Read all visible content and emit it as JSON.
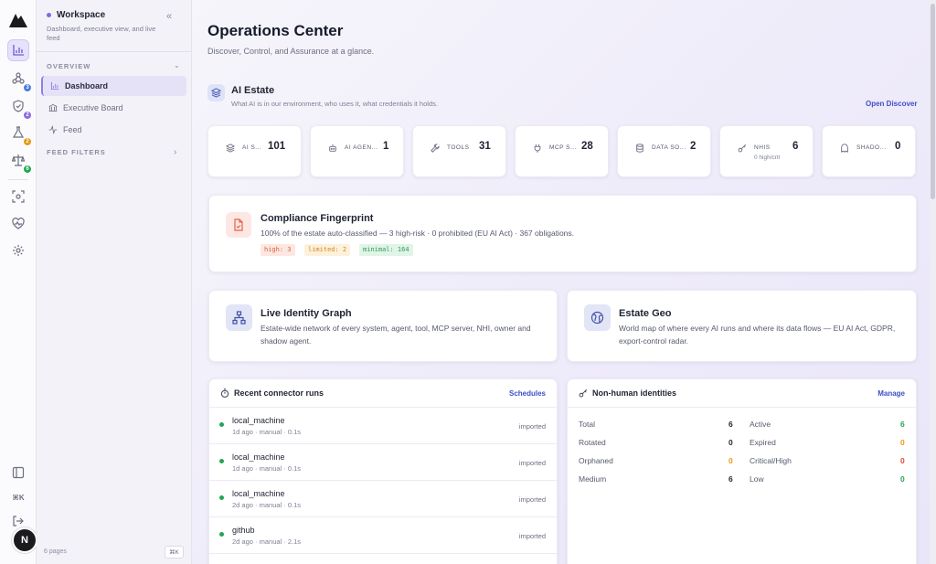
{
  "rail": {
    "badges": [
      "3",
      "2",
      "2",
      "6"
    ],
    "avatar": "N"
  },
  "sidebar": {
    "workspace_title": "Workspace",
    "workspace_sub": "Dashboard, executive view, and live feed",
    "sections": {
      "overview": "OVERVIEW",
      "feed_filters": "FEED FILTERS"
    },
    "items": [
      {
        "label": "Dashboard",
        "icon": "bar-chart-icon"
      },
      {
        "label": "Executive Board",
        "icon": "bank-icon"
      },
      {
        "label": "Feed",
        "icon": "activity-icon"
      }
    ],
    "footer_pages": "6 pages",
    "footer_shortcut": "⌘K"
  },
  "header": {
    "title": "Operations Center",
    "subtitle": "Discover, Control, and Assurance at a glance."
  },
  "estate": {
    "title": "AI Estate",
    "subtitle": "What AI is in our environment, who uses it, what credentials it holds.",
    "link": "Open Discover",
    "stats": [
      {
        "label": "AI S...",
        "value": "101",
        "icon": "layers-icon"
      },
      {
        "label": "AI AGEN...",
        "value": "1",
        "icon": "robot-icon"
      },
      {
        "label": "TOOLS",
        "value": "31",
        "icon": "wrench-icon"
      },
      {
        "label": "MCP S...",
        "value": "28",
        "icon": "plug-icon"
      },
      {
        "label": "DATA SO...",
        "value": "2",
        "icon": "database-icon"
      },
      {
        "label": "NHIS",
        "value": "6",
        "sub": "0 high/crit",
        "icon": "key-icon"
      },
      {
        "label": "SHADO...",
        "value": "0",
        "icon": "ghost-icon"
      }
    ]
  },
  "compliance": {
    "title": "Compliance Fingerprint",
    "desc": "100% of the estate auto-classified — 3 high-risk · 0 prohibited (EU AI Act) · 367 obligations.",
    "chips": [
      {
        "text": "high: 3",
        "color": "#d9603f",
        "bg": "#fde8e1"
      },
      {
        "text": "limited: 2",
        "color": "#d08a1c",
        "bg": "#fdf1dc"
      },
      {
        "text": "minimal: 164",
        "color": "#2f9a5a",
        "bg": "#e1f4e8"
      }
    ]
  },
  "features": [
    {
      "title": "Live Identity Graph",
      "desc": "Estate-wide network of every system, agent, tool, MCP server, NHI, owner and shadow agent."
    },
    {
      "title": "Estate Geo",
      "desc": "World map of where every AI runs and where its data flows — EU AI Act, GDPR, export-control radar."
    }
  ],
  "runs": {
    "title": "Recent connector runs",
    "link": "Schedules",
    "items": [
      {
        "name": "local_machine",
        "meta": "1d ago · manual · 0.1s",
        "status": "imported"
      },
      {
        "name": "local_machine",
        "meta": "1d ago · manual · 0.1s",
        "status": "imported"
      },
      {
        "name": "local_machine",
        "meta": "2d ago · manual · 0.1s",
        "status": "imported"
      },
      {
        "name": "github",
        "meta": "2d ago · manual · 2.1s",
        "status": "imported"
      }
    ]
  },
  "nhi": {
    "title": "Non-human identities",
    "link": "Manage",
    "left": [
      {
        "label": "Total",
        "value": "6",
        "color": "#1f2333"
      },
      {
        "label": "Rotated",
        "value": "0",
        "color": "#1f2333"
      },
      {
        "label": "Orphaned",
        "value": "0",
        "color": "#e39a14"
      },
      {
        "label": "Medium",
        "value": "6",
        "color": "#1f2333"
      }
    ],
    "right": [
      {
        "label": "Active",
        "value": "6",
        "color": "#22a652"
      },
      {
        "label": "Expired",
        "value": "0",
        "color": "#e39a14"
      },
      {
        "label": "Critical/High",
        "value": "0",
        "color": "#e0463a"
      },
      {
        "label": "Low",
        "value": "0",
        "color": "#22a652"
      }
    ]
  }
}
